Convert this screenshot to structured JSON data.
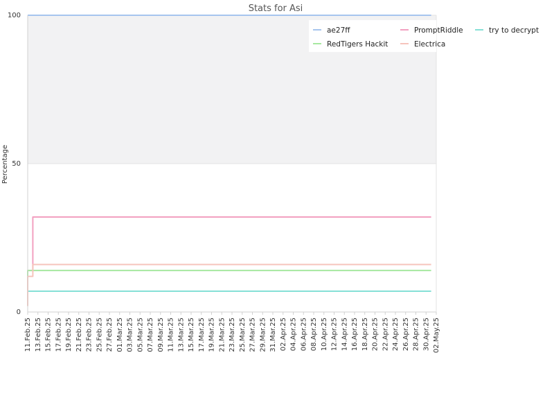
{
  "chart_data": {
    "type": "line",
    "title": "Stats for Asi",
    "xlabel": "",
    "ylabel": "Percentage",
    "ylim": [
      0,
      100
    ],
    "xlim": [
      "2025-02-11",
      "2025-05-02"
    ],
    "yticks": [
      0,
      50,
      100
    ],
    "xticks": [
      "11.Feb.25",
      "13.Feb.25",
      "15.Feb.25",
      "17.Feb.25",
      "19.Feb.25",
      "21.Feb.25",
      "23.Feb.25",
      "25.Feb.25",
      "27.Feb.25",
      "01.Mar.25",
      "03.Mar.25",
      "05.Mar.25",
      "07.Mar.25",
      "09.Mar.25",
      "11.Mar.25",
      "13.Mar.25",
      "15.Mar.25",
      "17.Mar.25",
      "19.Mar.25",
      "21.Mar.25",
      "23.Mar.25",
      "25.Mar.25",
      "27.Mar.25",
      "29.Mar.25",
      "31.Mar.25",
      "02.Apr.25",
      "04.Apr.25",
      "06.Apr.25",
      "08.Apr.25",
      "10.Apr.25",
      "12.Apr.25",
      "14.Apr.25",
      "16.Apr.25",
      "18.Apr.25",
      "20.Apr.25",
      "22.Apr.25",
      "24.Apr.25",
      "26.Apr.25",
      "28.Apr.25",
      "30.Apr.25",
      "02.May.25"
    ],
    "grid": true,
    "legend_position": "top-right",
    "shaded_band": [
      50,
      100
    ],
    "series": [
      {
        "name": "ae27ff",
        "color": "#a6c4ee",
        "points": [
          [
            "2025-02-11",
            100
          ],
          [
            "2025-05-01",
            100
          ]
        ]
      },
      {
        "name": "PromptRiddle",
        "color": "#f2a0c0",
        "points": [
          [
            "2025-02-11",
            14
          ],
          [
            "2025-02-12",
            18
          ],
          [
            "2025-02-12",
            21
          ],
          [
            "2025-02-12",
            24
          ],
          [
            "2025-02-12",
            32
          ],
          [
            "2025-05-01",
            32
          ]
        ]
      },
      {
        "name": "try to decrypt",
        "color": "#85e0d6",
        "points": [
          [
            "2025-02-11",
            7
          ],
          [
            "2025-05-01",
            7
          ]
        ]
      },
      {
        "name": "RedTigers Hackit",
        "color": "#a6e8a0",
        "points": [
          [
            "2025-02-11",
            3
          ],
          [
            "2025-02-11",
            14
          ],
          [
            "2025-05-01",
            14
          ]
        ]
      },
      {
        "name": "Electrica",
        "color": "#f6c4bc",
        "points": [
          [
            "2025-02-11",
            2
          ],
          [
            "2025-02-11",
            12
          ],
          [
            "2025-02-12",
            16
          ],
          [
            "2025-05-01",
            16
          ]
        ]
      }
    ]
  }
}
